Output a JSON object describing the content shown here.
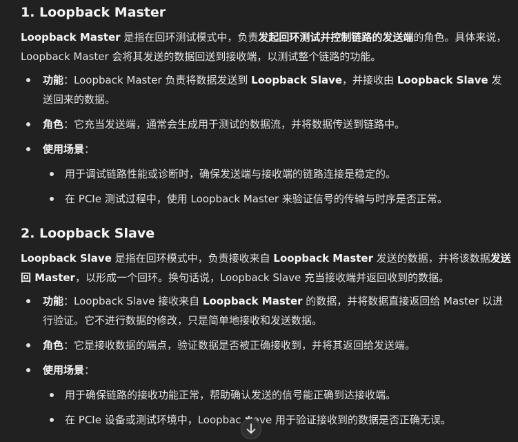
{
  "section1": {
    "title": "1. Loopback Master",
    "intro": [
      {
        "t": "Loopback Master",
        "b": true
      },
      {
        "t": " 是指在回环测试模式中，负责",
        "b": false
      },
      {
        "t": "发起回环测试并控制链路的发送端",
        "b": true
      },
      {
        "t": "的角色。具体来说，Loopback Master 会将其发送的数据回送到接收端，以测试整个链路的功能。",
        "b": false
      }
    ],
    "bullets": [
      {
        "parts": [
          {
            "t": "功能",
            "b": true
          },
          {
            "t": "：Loopback Master 负责将数据发送到 ",
            "b": false
          },
          {
            "t": "Loopback Slave",
            "b": true
          },
          {
            "t": "，并接收由 ",
            "b": false
          },
          {
            "t": "Loopback Slave",
            "b": true
          },
          {
            "t": " 发送回来的数据。",
            "b": false
          }
        ]
      },
      {
        "parts": [
          {
            "t": "角色",
            "b": true
          },
          {
            "t": "：它充当发送端，通常会生成用于测试的数据流，并将数据传送到链路中。",
            "b": false
          }
        ]
      },
      {
        "parts": [
          {
            "t": "使用场景",
            "b": true
          },
          {
            "t": "：",
            "b": false
          }
        ],
        "sub": [
          "用于调试链路性能或诊断时，确保发送端与接收端的链路连接是稳定的。",
          "在 PCIe 测试过程中，使用 Loopback Master 来验证信号的传输与时序是否正常。"
        ]
      }
    ]
  },
  "section2": {
    "title": "2. Loopback Slave",
    "intro": [
      {
        "t": "Loopback Slave",
        "b": true
      },
      {
        "t": " 是指在回环模式中，负责接收来自 ",
        "b": false
      },
      {
        "t": "Loopback Master",
        "b": true
      },
      {
        "t": " 发送的数据，并将该数据",
        "b": false
      },
      {
        "t": "发送回 Master",
        "b": true
      },
      {
        "t": "，以形成一个回环。换句话说，Loopback Slave 充当接收端并返回收到的数据。",
        "b": false
      }
    ],
    "bullets": [
      {
        "parts": [
          {
            "t": "功能",
            "b": true
          },
          {
            "t": "：Loopback Slave 接收来自 ",
            "b": false
          },
          {
            "t": "Loopback Master",
            "b": true
          },
          {
            "t": " 的数据，并将数据直接返回给 Master 以进行验证。它不进行数据的修改，只是简单地接收和发送数据。",
            "b": false
          }
        ]
      },
      {
        "parts": [
          {
            "t": "角色",
            "b": true
          },
          {
            "t": "：它是接收数据的端点，验证数据是否被正确接收到，并将其返回给发送端。",
            "b": false
          }
        ]
      },
      {
        "parts": [
          {
            "t": "使用场景",
            "b": true
          },
          {
            "t": "：",
            "b": false
          }
        ],
        "sub": [
          "用于确保链路的接收功能正常，帮助确认发送的信号能正确到达接收端。",
          "在 PCIe 设备或测试环境中，Loopbac ✱ave 用于验证接收到的数据是否正确无误。"
        ]
      }
    ]
  },
  "scroll_button": {
    "icon": "arrow-down-icon"
  }
}
